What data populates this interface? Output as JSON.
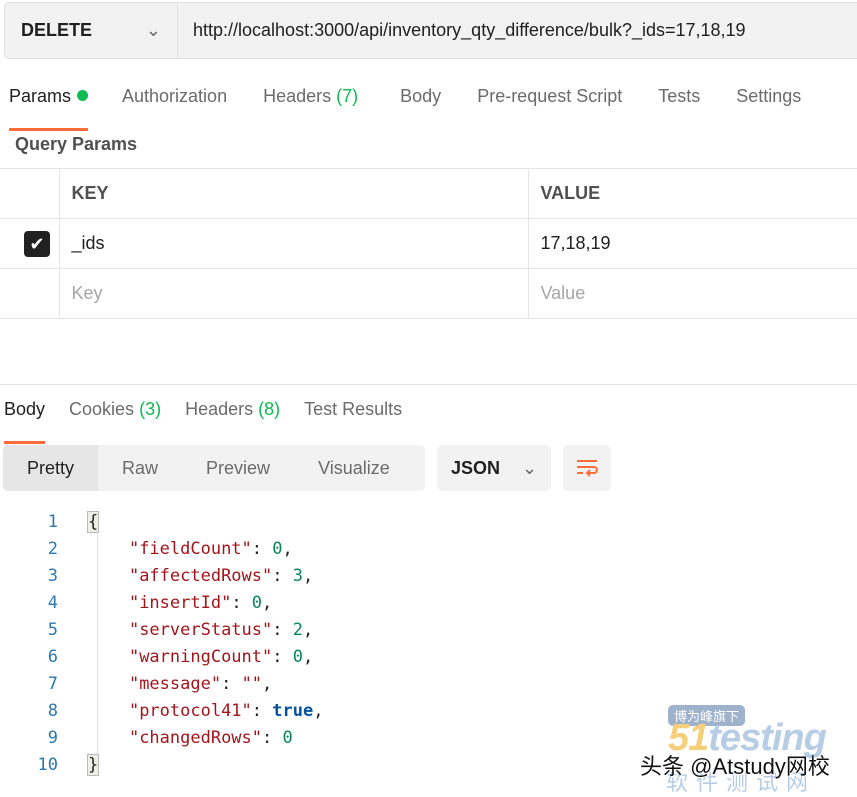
{
  "request": {
    "method": "DELETE",
    "url": "http://localhost:3000/api/inventory_qty_difference/bulk?_ids=17,18,19"
  },
  "req_tabs": [
    {
      "label": "Params"
    },
    {
      "label": "Authorization"
    },
    {
      "label": "Headers",
      "count": "(7)"
    },
    {
      "label": "Body"
    },
    {
      "label": "Pre-request Script"
    },
    {
      "label": "Tests"
    },
    {
      "label": "Settings"
    }
  ],
  "query": {
    "title": "Query Params",
    "key_header": "KEY",
    "value_header": "VALUE",
    "rows": [
      {
        "checked": true,
        "key": "_ids",
        "value": "17,18,19"
      }
    ],
    "key_placeholder": "Key",
    "value_placeholder": "Value"
  },
  "resp_tabs": [
    {
      "label": "Body"
    },
    {
      "label": "Cookies",
      "count": "(3)"
    },
    {
      "label": "Headers",
      "count": "(8)"
    },
    {
      "label": "Test Results"
    }
  ],
  "view_modes": [
    "Pretty",
    "Raw",
    "Preview",
    "Visualize"
  ],
  "format": "JSON",
  "accent": "#ff6c37",
  "code": {
    "open": "{",
    "close": "}",
    "lines": [
      {
        "key": "\"fieldCount\"",
        "value": "0",
        "type": "n",
        "comma": ","
      },
      {
        "key": "\"affectedRows\"",
        "value": "3",
        "type": "n",
        "comma": ","
      },
      {
        "key": "\"insertId\"",
        "value": "0",
        "type": "n",
        "comma": ","
      },
      {
        "key": "\"serverStatus\"",
        "value": "2",
        "type": "n",
        "comma": ","
      },
      {
        "key": "\"warningCount\"",
        "value": "0",
        "type": "n",
        "comma": ","
      },
      {
        "key": "\"message\"",
        "value": "\"\"",
        "type": "s",
        "comma": ","
      },
      {
        "key": "\"protocol41\"",
        "value": "true",
        "type": "b",
        "comma": ","
      },
      {
        "key": "\"changedRows\"",
        "value": "0",
        "type": "n",
        "comma": ""
      }
    ]
  },
  "watermark": {
    "badge": "博为峰旗下",
    "logo": "51testing",
    "sub": "软件测试网",
    "credit": "头条 @Atstudy网校"
  }
}
